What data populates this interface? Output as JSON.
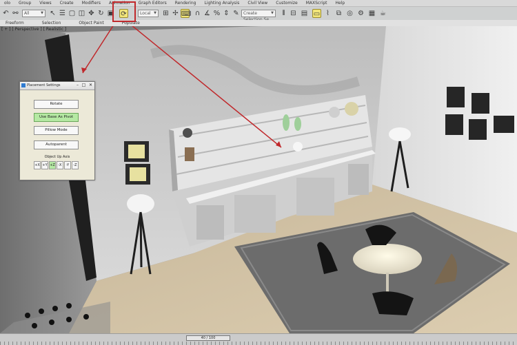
{
  "menubar": {
    "items": [
      "olo",
      "Group",
      "Views",
      "Create",
      "Modifiers",
      "Animation",
      "Graph Editors",
      "Rendering",
      "Lighting Analysis",
      "Civil View",
      "Customize",
      "MAXScript",
      "Help"
    ]
  },
  "toolbar": {
    "selection_filter": "All",
    "reference_coord": "Local",
    "named_selection": "Create Selection Se"
  },
  "ribbon": {
    "tabs": [
      "Freeform",
      "Selection",
      "Object Paint",
      "Populate"
    ]
  },
  "viewport": {
    "label": "[ + ] [ Perspective ] [ Realistic ]"
  },
  "dialog": {
    "title": "Placement Settings",
    "buttons": [
      "Rotate",
      "Use Base As Pivot",
      "Pillow Mode",
      "Autoparent"
    ],
    "use_base_as_pivot_checked": true,
    "object_up_axis_label": "Object Up Axis",
    "axis_buttons": [
      "+X",
      "+Y",
      "+Z",
      "-X",
      "-Y",
      "-Z"
    ],
    "active_axis": "+Z"
  },
  "status": {
    "time_slider": "40 / 100"
  },
  "colors": {
    "highlight_red": "#c0282b",
    "active_green": "#b5e9a3",
    "active_tool_yellow": "#f2e67a"
  },
  "icons": [
    "select-icon",
    "move-icon",
    "rotate-icon",
    "scale-icon",
    "placement-tool-icon",
    "snap-icon",
    "mirror-icon",
    "align-icon",
    "render-icon"
  ]
}
